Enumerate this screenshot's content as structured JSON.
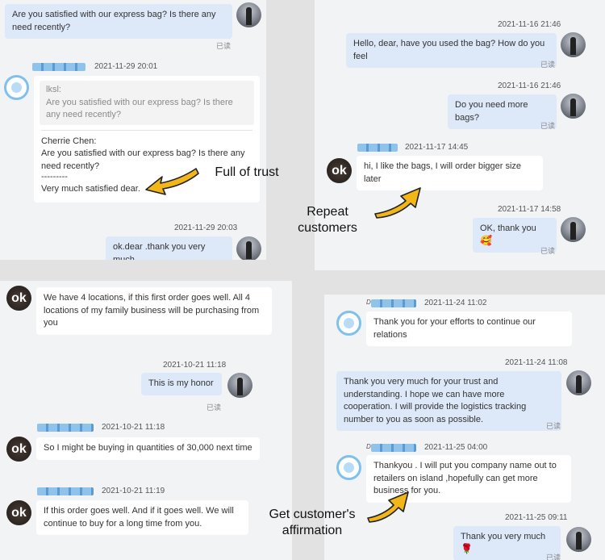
{
  "read_label": "已读",
  "panel1": {
    "msg_top": "Are you satisfied with our express bag? Is there any need recently?",
    "sender_label": "",
    "timestamp1": "2021-11-29 20:01",
    "quote_author": "lksl:",
    "quote_text": "Are you satisfied with our express bag? Is there any need recently?",
    "reply_author": "Cherrie Chen:",
    "reply_text": "Are you satisfied with our express bag? Is there any need recently?",
    "reply_dashes": "---------",
    "reply_answer": "Very much satisfied dear.",
    "timestamp2": "2021-11-29 20:03",
    "msg_out": "ok.dear .thank you very much"
  },
  "panel2": {
    "timestamp1": "2021-11-16 21:46",
    "msg1": "Hello, dear, have you used the bag? How do you feel",
    "timestamp2": "2021-11-16 21:46",
    "msg2": "Do you need more bags?",
    "timestamp3": "2021-11-17 14:45",
    "msg3": "hi, I like the bags, I will order bigger size later",
    "timestamp4": "2021-11-17 14:58",
    "msg4": "OK, thank you",
    "msg4_emoji": "🥰"
  },
  "panel3": {
    "msg1": "We have 4 locations, if this first order goes well. All 4 locations of my family business will be purchasing from you",
    "timestamp1": "2021-10-21 11:18",
    "msg2": "This is my honor",
    "timestamp2": "2021-10-21 11:18",
    "msg3": "So I might be buying in quantities of 30,000 next time",
    "timestamp3": "2021-10-21 11:19",
    "msg4": "If this order goes well. And if it goes well. We will continue to buy for a long time from you."
  },
  "panel4": {
    "sender1": "D",
    "timestamp1": "2021-11-24 11:02",
    "msg1": "Thank you for your efforts to continue our relations",
    "timestamp2": "2021-11-24 11:08",
    "msg2": "Thank you very much for your trust and understanding. I hope we can have more cooperation. I will provide the logistics tracking number to you as soon as possible.",
    "sender2": "D",
    "timestamp3": "2021-11-25 04:00",
    "msg3": "Thankyou . I will put you company name out to retailers on island ,hopefully can get more business for you.",
    "timestamp4": "2021-11-25 09:11",
    "msg4": "Thank you very much",
    "msg4_emoji": "🌹"
  },
  "captions": {
    "trust": "Full of trust",
    "repeat": "Repeat customers",
    "affirmation": "Get customer's affirmation"
  },
  "avatar_ok_text": "ok",
  "colors": {
    "outgoing_bubble": "#dde8f8",
    "incoming_bubble": "#ffffff",
    "arrow_fill": "#f2b619",
    "panel_bg": "#f2f3f5"
  }
}
